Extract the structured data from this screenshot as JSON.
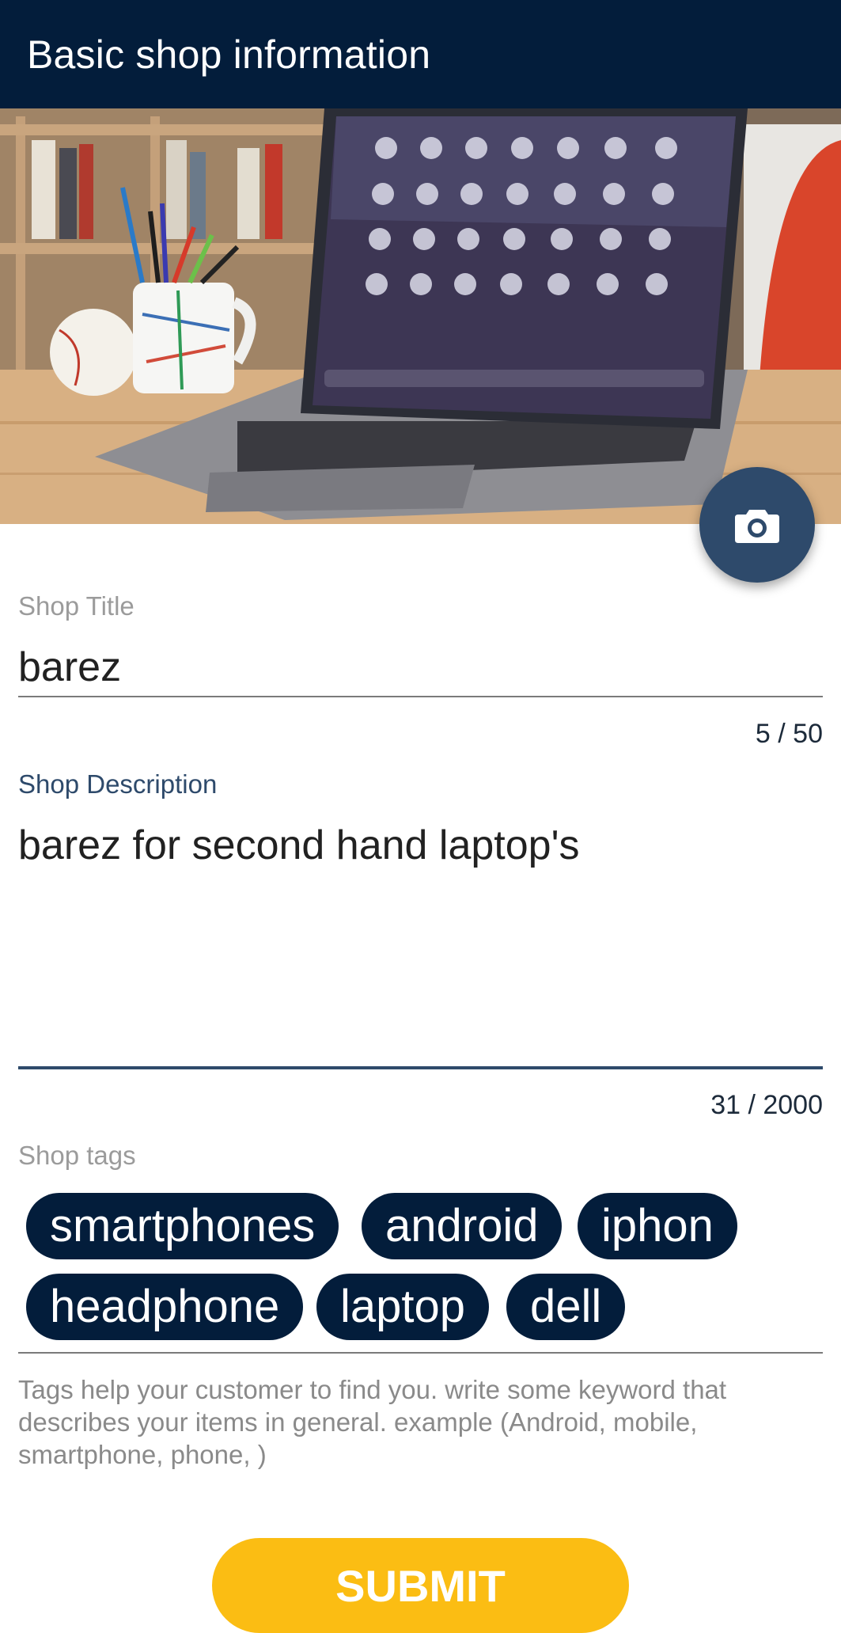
{
  "appbar": {
    "title": "Basic shop information"
  },
  "hero": {
    "camera_icon": "camera-icon"
  },
  "form": {
    "title_label": "Shop Title",
    "title_value": "barez",
    "title_counter": "5 / 50",
    "description_label": "Shop Description",
    "description_value": "barez for second hand laptop's",
    "description_counter": "31 / 2000",
    "tags_label": "Shop tags",
    "tags": [
      "smartphones",
      "android",
      "iphon",
      "headphone",
      "laptop",
      "dell"
    ],
    "tags_helper": "Tags help your customer to find you. write some keyword that describes your items in general. example (Android, mobile, smartphone, phone, )",
    "submit_label": "SUBMIT"
  },
  "colors": {
    "appbar": "#031d3b",
    "accent": "#2e4a6b",
    "chip": "#031d3b",
    "submit": "#fbbd13"
  }
}
